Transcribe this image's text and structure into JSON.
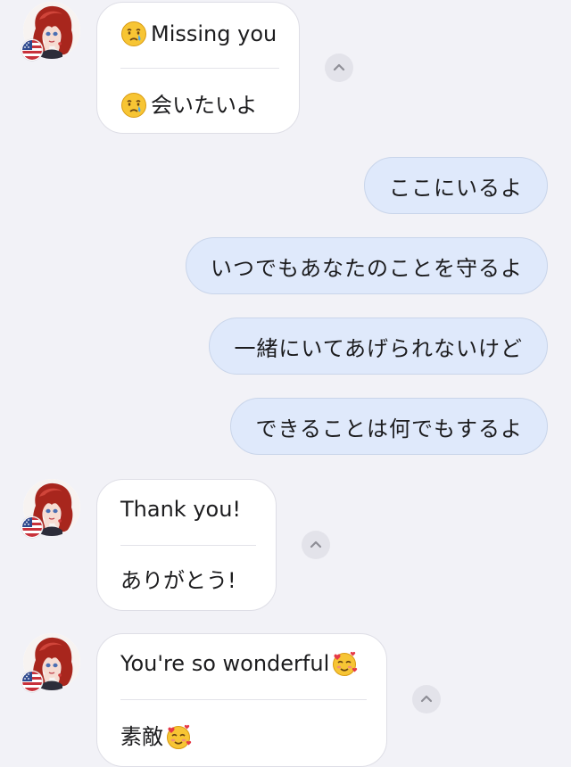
{
  "partner": {
    "avatar": "anime-redhead-avatar",
    "flag": "us-flag"
  },
  "messages": [
    {
      "direction": "incoming",
      "original": "Missing you",
      "translation": "会いたいよ",
      "emoji": "crying-face",
      "collapse_icon": "chevron-up-icon"
    },
    {
      "direction": "outgoing",
      "text": "ここにいるよ"
    },
    {
      "direction": "outgoing",
      "text": "いつでもあなたのことを守るよ"
    },
    {
      "direction": "outgoing",
      "text": "一緒にいてあげられないけど"
    },
    {
      "direction": "outgoing",
      "text": "できることは何でもするよ"
    },
    {
      "direction": "incoming",
      "original": "Thank you!",
      "translation": "ありがとう!",
      "collapse_icon": "chevron-up-icon"
    },
    {
      "direction": "incoming",
      "original": "You're so wonderful",
      "translation": "素敵",
      "emoji": "smiling-face-with-hearts",
      "collapse_icon": "chevron-up-icon"
    }
  ],
  "colors": {
    "background": "#f2f2f7",
    "incoming_bubble": "#ffffff",
    "outgoing_bubble": "#dfe9fb",
    "outgoing_border": "#c9d5ea",
    "text": "#1c1c1e"
  }
}
